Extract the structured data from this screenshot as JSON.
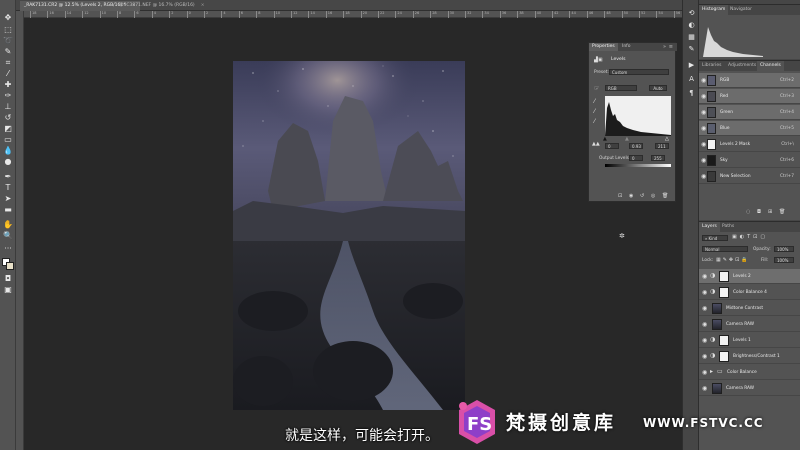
{
  "document_tabs": [
    {
      "label": "_RAK7131.CR2 @ 12.5% (Levels 2, RGB/16) *",
      "close": "×",
      "active": true
    },
    {
      "label": "DSC3871.NEF @ 16.7% (RGB/16)",
      "close": "×",
      "active": false
    }
  ],
  "ruler": {
    "ticks": [
      "18",
      "16",
      "14",
      "12",
      "10",
      "8",
      "6",
      "4",
      "2",
      "0",
      "2",
      "4",
      "6",
      "8",
      "10",
      "12",
      "14",
      "16",
      "18",
      "20",
      "22",
      "24",
      "26",
      "28",
      "30",
      "32",
      "34",
      "36",
      "38",
      "40",
      "42",
      "44",
      "46",
      "48",
      "50",
      "52",
      "54",
      "56"
    ]
  },
  "properties": {
    "tabs": [
      "Properties",
      "Info"
    ],
    "adjustment_title": "Levels",
    "preset_label": "Preset:",
    "preset_value": "Custom",
    "channel_value": "RGB",
    "auto_label": "Auto",
    "input_levels": [
      "0",
      "0.93",
      "211"
    ],
    "output_label": "Output Levels:",
    "output_levels": [
      "0",
      "255"
    ]
  },
  "histogram_panel": {
    "tabs": [
      "Histogram",
      "Navigator"
    ]
  },
  "channels_panel": {
    "tabs": [
      "Libraries",
      "Adjustments",
      "Channels"
    ],
    "channels": [
      {
        "name": "RGB",
        "key": "Ctrl+2",
        "thumb": "#5a5c70",
        "selected": true
      },
      {
        "name": "Red",
        "key": "Ctrl+3",
        "thumb": "#4a4a52",
        "selected": true
      },
      {
        "name": "Green",
        "key": "Ctrl+4",
        "thumb": "#4d4f56",
        "selected": true
      },
      {
        "name": "Blue",
        "key": "Ctrl+5",
        "thumb": "#5a5e6e",
        "selected": true
      },
      {
        "name": "Levels 2 Mask",
        "key": "Ctrl+\\",
        "thumb": "#f2f2f2",
        "selected": false
      },
      {
        "name": "Sky",
        "key": "Ctrl+6",
        "thumb": "#1a1a1a",
        "selected": false
      },
      {
        "name": "New Selection",
        "key": "Ctrl+7",
        "thumb": "#3a3a3a",
        "selected": false
      }
    ]
  },
  "layers_panel": {
    "tabs": [
      "Layers",
      "Paths"
    ],
    "kind_label": "Kind",
    "blend_mode": "Normal",
    "opacity_label": "Opacity:",
    "opacity_value": "100%",
    "lock_label": "Lock:",
    "fill_label": "Fill:",
    "fill_value": "100%",
    "layers": [
      {
        "name": "Levels 2",
        "type": "adjust",
        "selected": true
      },
      {
        "name": "Color Balance 4",
        "type": "adjust",
        "selected": false
      },
      {
        "name": "Midtone Contrast",
        "type": "image",
        "selected": false
      },
      {
        "name": "Camera RAW",
        "type": "image",
        "selected": false
      },
      {
        "name": "Levels 1",
        "type": "adjust",
        "selected": false
      },
      {
        "name": "Brightness/Contrast 1",
        "type": "adjust",
        "selected": false
      },
      {
        "name": "Color Balance",
        "type": "group",
        "selected": false
      },
      {
        "name": "Camera RAW",
        "type": "image",
        "selected": false
      }
    ]
  },
  "subtitle": "就是这样，可能会打开。",
  "watermark": {
    "logo_text": "FS",
    "title": "梵摄创意库",
    "url": "WWW.FSTVC.CC"
  }
}
